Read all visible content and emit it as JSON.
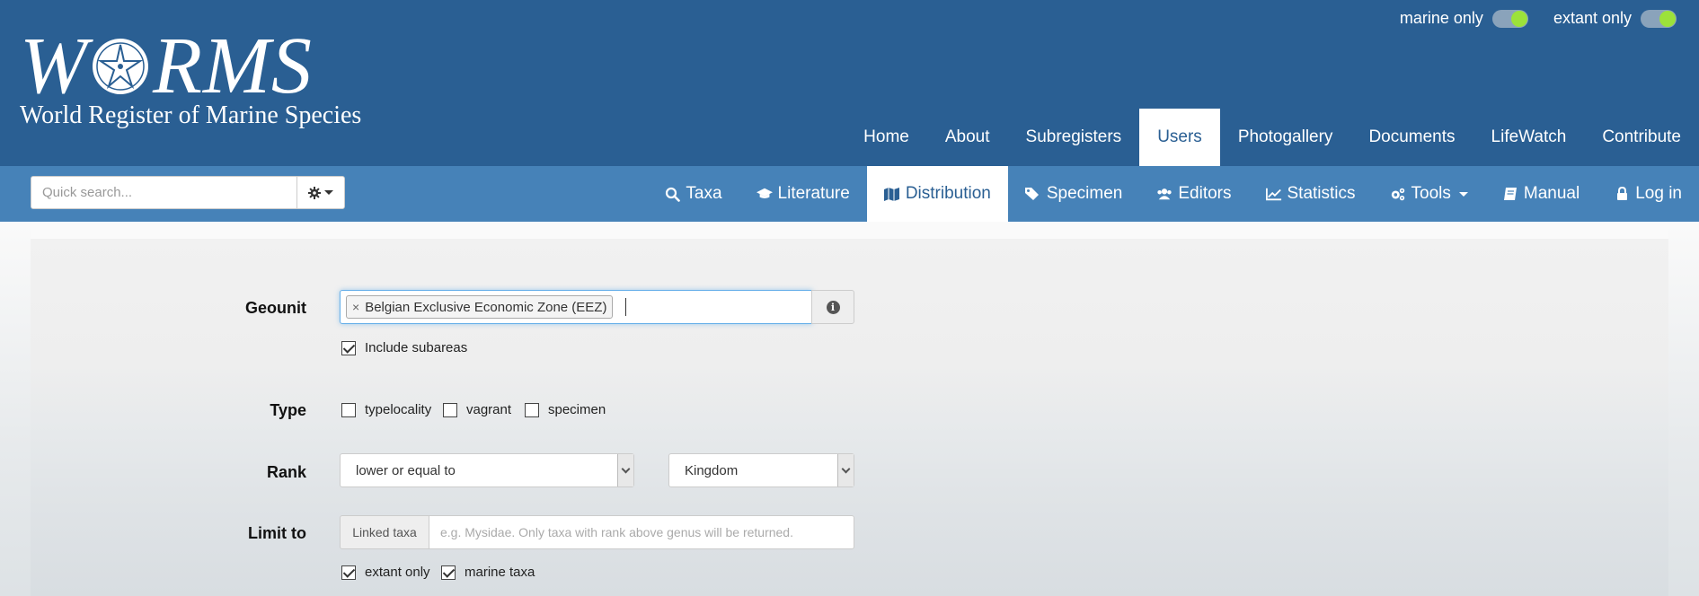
{
  "logo": {
    "title_left": "W",
    "title_right": "RMS",
    "subtitle": "World Register of Marine Species"
  },
  "toggles": [
    {
      "label": "marine only",
      "on": true
    },
    {
      "label": "extant only",
      "on": true
    }
  ],
  "topnav": [
    {
      "label": "Home",
      "active": false
    },
    {
      "label": "About",
      "active": false
    },
    {
      "label": "Subregisters",
      "active": false
    },
    {
      "label": "Users",
      "active": true
    },
    {
      "label": "Photogallery",
      "active": false
    },
    {
      "label": "Documents",
      "active": false
    },
    {
      "label": "LifeWatch",
      "active": false
    },
    {
      "label": "Contribute",
      "active": false
    }
  ],
  "quicksearch": {
    "placeholder": "Quick search..."
  },
  "subnav": [
    {
      "label": "Taxa",
      "icon": "search-icon",
      "active": false
    },
    {
      "label": "Literature",
      "icon": "graduation-cap-icon",
      "active": false
    },
    {
      "label": "Distribution",
      "icon": "map-icon",
      "active": true
    },
    {
      "label": "Specimen",
      "icon": "tags-icon",
      "active": false
    },
    {
      "label": "Editors",
      "icon": "users-icon",
      "active": false
    },
    {
      "label": "Statistics",
      "icon": "line-chart-icon",
      "active": false
    },
    {
      "label": "Tools",
      "icon": "cogs-icon",
      "active": false
    },
    {
      "label": "Manual",
      "icon": "book-icon",
      "active": false
    },
    {
      "label": "Log in",
      "icon": "lock-icon",
      "active": false
    }
  ],
  "form": {
    "geounit_label": "Geounit",
    "geounit_tag": "Belgian Exclusive Economic Zone (EEZ)",
    "geounit_tag_remove": "×",
    "include_subareas": {
      "label": "Include subareas",
      "checked": true
    },
    "type_label": "Type",
    "types": [
      {
        "label": "typelocality",
        "checked": false
      },
      {
        "label": "vagrant",
        "checked": false
      },
      {
        "label": "specimen",
        "checked": false
      }
    ],
    "rank_label": "Rank",
    "rank_operator": "lower or equal to",
    "rank_value": "Kingdom",
    "limit_label": "Limit to",
    "linked_taxa_addon": "Linked taxa",
    "linked_taxa_placeholder": "e.g. Mysidae. Only taxa with rank above genus will be returned.",
    "limits": [
      {
        "label": "extant only",
        "checked": true
      },
      {
        "label": "marine taxa",
        "checked": true
      }
    ]
  },
  "colors": {
    "header": "#2a5f93",
    "subbar": "#4682b8",
    "toggle_on": "#9ce23a"
  }
}
